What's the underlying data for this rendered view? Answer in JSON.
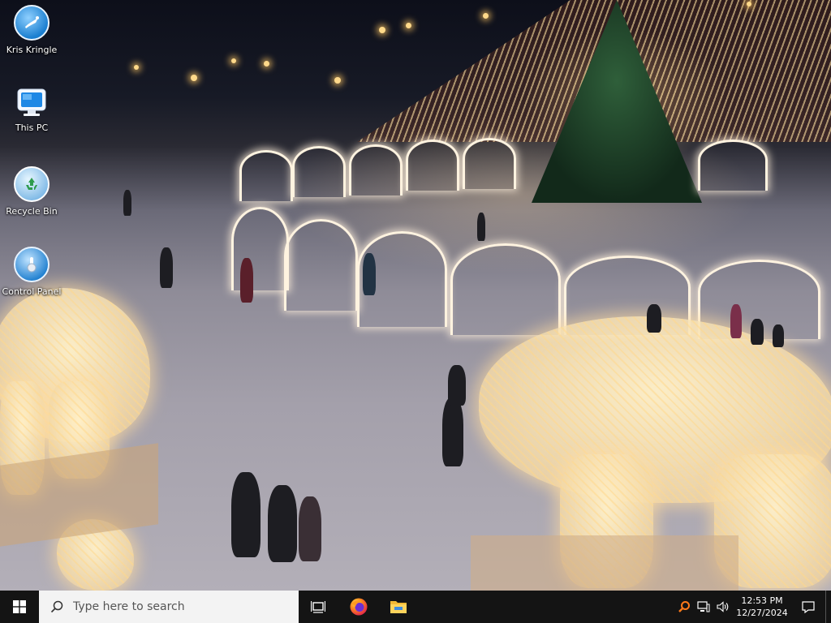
{
  "desktop": {
    "icons": [
      {
        "label": "Kris Kringle"
      },
      {
        "label": "This PC"
      },
      {
        "label": "Recycle Bin"
      },
      {
        "label": "Control Panel"
      }
    ]
  },
  "taskbar": {
    "search_placeholder": "Type here to search",
    "pinned": [
      "task-view-icon",
      "firefox-icon",
      "file-explorer-icon"
    ],
    "tray": {
      "time": "12:53 PM",
      "date": "12/27/2024"
    }
  },
  "colors": {
    "taskbar": "#141414",
    "search_bg": "#f3f3f3",
    "accent_blue": "#1e88e5"
  }
}
